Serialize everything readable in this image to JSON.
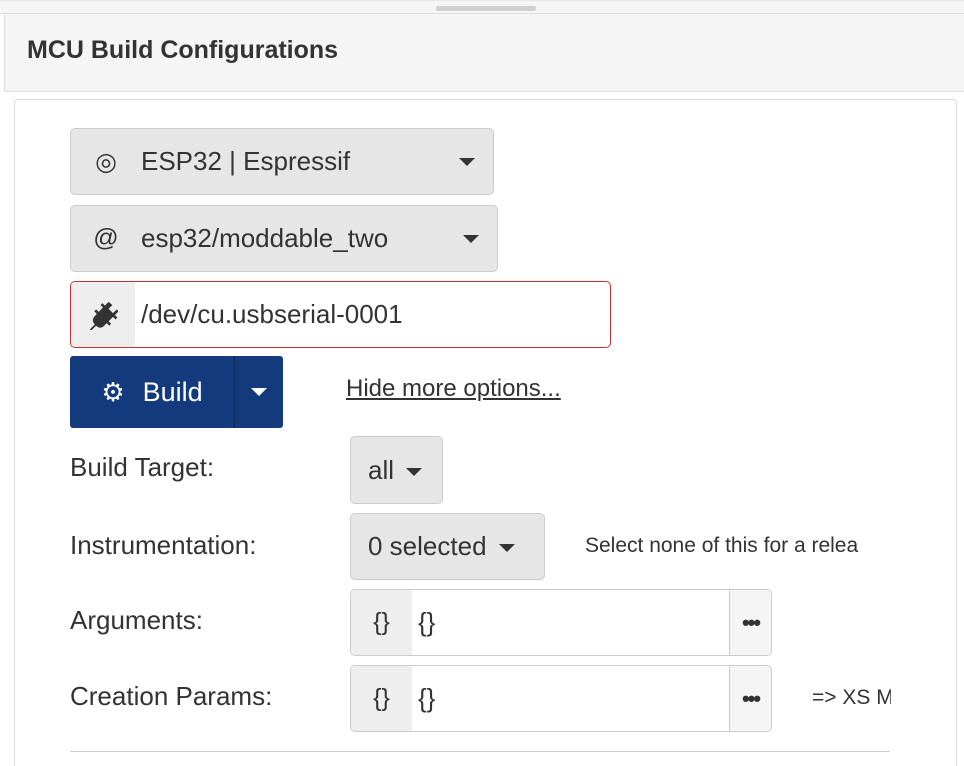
{
  "panel": {
    "title": "MCU Build Configurations"
  },
  "platform": {
    "icon": "target-icon",
    "label": "ESP32 | Espressif"
  },
  "subplatform": {
    "icon": "at-icon",
    "label": "esp32/moddable_two"
  },
  "port": {
    "icon": "plug-icon",
    "value": "/dev/cu.usbserial-0001"
  },
  "build": {
    "icon": "gear-icon",
    "label": "Build"
  },
  "options_link": "Hide more options...",
  "fields": {
    "build_target": {
      "label": "Build Target:",
      "value": "all"
    },
    "instrumentation": {
      "label": "Instrumentation:",
      "value": "0 selected",
      "hint": "Select none of this for a relea"
    },
    "arguments": {
      "label": "Arguments:",
      "addon": "{}",
      "value": "{}",
      "more": "•••"
    },
    "creation_params": {
      "label": "Creation Params:",
      "addon": "{}",
      "value": "{}",
      "more": "•••",
      "hint": "=> XS M"
    }
  },
  "colors": {
    "primary": "#133a7c",
    "error_border": "#c9302c",
    "addon_bg": "#eeeeee",
    "button_bg": "#e6e6e6"
  }
}
